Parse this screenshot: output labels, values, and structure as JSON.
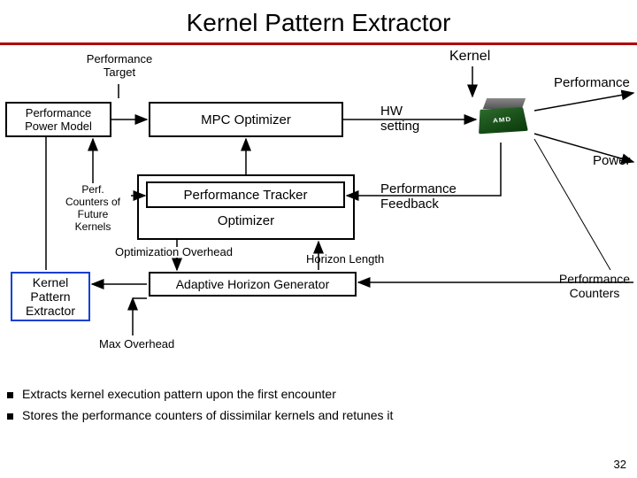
{
  "title": "Kernel Pattern Extractor",
  "labels": {
    "perfTarget": "Performance\nTarget",
    "kernel": "Kernel",
    "performance": "Performance",
    "power": "Power",
    "hwSetting": "HW\nsetting",
    "perfCounters": "Perf.\nCounters of\nFuture\nKernels",
    "optOverhead": "Optimization Overhead",
    "horizonLength": "Horizon Length",
    "maxOverhead": "Max Overhead",
    "perfCountersRight": "Performance\nCounters",
    "perfFeedback": "Performance\nFeedback"
  },
  "boxes": {
    "powerModel": "Performance\nPower Model",
    "mpcOptimizer": "MPC Optimizer",
    "perfTracker": "Performance Tracker",
    "optimizer": "Optimizer",
    "adaptiveHorizon": "Adaptive Horizon Generator",
    "kpe": "Kernel\nPattern\nExtractor"
  },
  "bullets": [
    "Extracts kernel execution pattern upon the first encounter",
    "Stores the performance counters of dissimilar kernels and retunes it"
  ],
  "slideNumber": "32",
  "chipBrand": "AMD"
}
